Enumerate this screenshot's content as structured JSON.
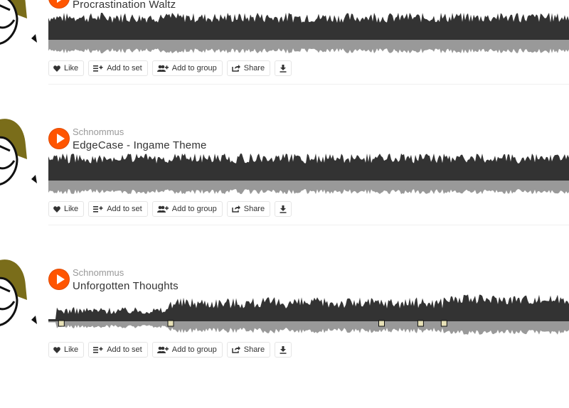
{
  "tracks": [
    {
      "artist": "",
      "title": "Procrastination Waltz",
      "waveform": "flat",
      "comments": []
    },
    {
      "artist": "Schnommus",
      "title": "EdgeCase - Ingame Theme",
      "waveform": "flat",
      "comments": []
    },
    {
      "artist": "Schnommus",
      "title": "Unforgotten Thoughts",
      "waveform": "ramp",
      "comments": [
        0.025,
        0.235,
        0.64,
        0.715,
        0.76
      ]
    }
  ],
  "actions": {
    "like": "Like",
    "add_to_set": "Add to set",
    "add_to_group": "Add to group",
    "share": "Share"
  },
  "icons": {
    "play": "play-icon",
    "like": "heart-icon",
    "add_to_set": "playlist-add-icon",
    "add_to_group": "group-add-icon",
    "share": "share-icon",
    "download": "download-icon"
  },
  "colors": {
    "accent": "#ff5500",
    "waveform_top": "#333333",
    "waveform_bottom": "#999999"
  }
}
